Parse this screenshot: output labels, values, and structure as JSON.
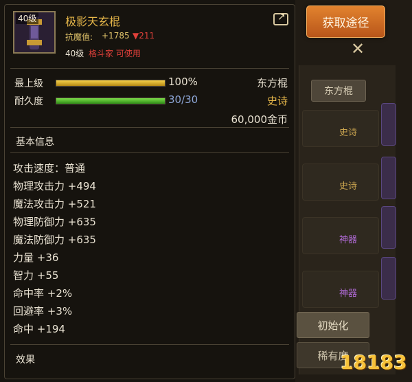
{
  "window": {
    "source_button": "获取途径",
    "bg_tab": "东方棍",
    "bg_tags": [
      "史诗",
      "史诗",
      "神器",
      "神器"
    ],
    "bg_init_button": "初始化",
    "bg_rarity_button": "稀有度",
    "logo_text": "18183"
  },
  "item": {
    "level_badge": "40级",
    "name": "极影天玄棍",
    "resist_label": "抗魔值:",
    "resist_value": "+1785",
    "resist_diff": "▼211",
    "req_level": "40级",
    "req_class": "格斗家 可使用",
    "grade_label": "最上级",
    "grade_percent": 100,
    "grade_value": "100%",
    "durability_label": "耐久度",
    "durability_current": 30,
    "durability_max": 30,
    "durability_value": "30/30",
    "weapon_type": "东方棍",
    "rarity": "史诗",
    "price": "60,000金币",
    "basic_info_title": "基本信息",
    "attributes": [
      "攻击速度：普通",
      "物理攻击力 +494",
      "魔法攻击力 +521",
      "物理防御力 +635",
      "魔法防御力 +635",
      "力量 +36",
      "智力 +55",
      "命中率 +2%",
      "回避率 +3%",
      "命中 +194"
    ],
    "effects_title": "效果"
  },
  "colors": {
    "name": "#e8b84a",
    "negative": "#e0403a",
    "durability_text": "#8ea7d8",
    "source_button": "#d4702a"
  }
}
